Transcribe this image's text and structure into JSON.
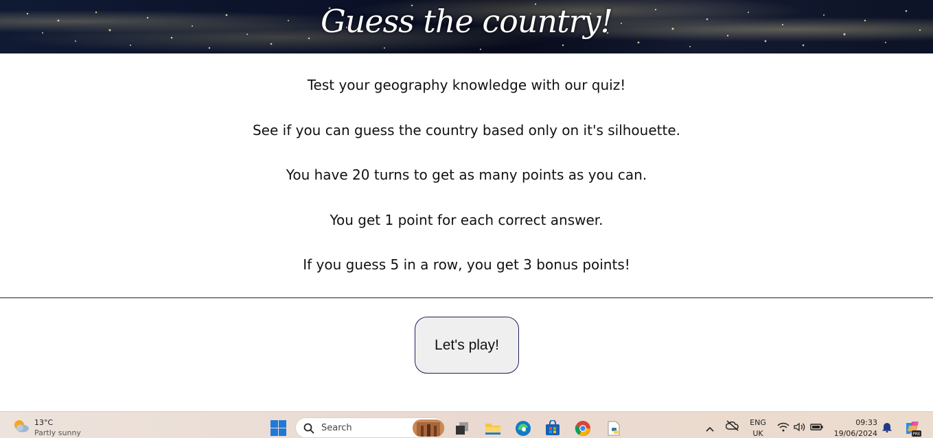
{
  "header": {
    "title": "Guess the country!"
  },
  "intro": {
    "lines": [
      "Test your geography knowledge with our quiz!",
      "See if you can guess the country based only on it's silhouette.",
      "You have 20 turns to get as many points as you can.",
      "You get 1 point for each correct answer.",
      "If you guess 5 in a row, you get 3 bonus points!"
    ]
  },
  "actions": {
    "play_label": "Let's play!"
  },
  "taskbar": {
    "weather": {
      "temperature": "13°C",
      "description": "Partly sunny",
      "icon": "partly-sunny-icon"
    },
    "search": {
      "placeholder": "Search"
    },
    "apps": [
      {
        "name": "start",
        "icon": "windows-logo-icon"
      },
      {
        "name": "task-view",
        "icon": "task-view-icon"
      },
      {
        "name": "file-explorer",
        "icon": "folder-icon"
      },
      {
        "name": "edge",
        "icon": "edge-icon"
      },
      {
        "name": "store",
        "icon": "store-icon"
      },
      {
        "name": "chrome",
        "icon": "chrome-icon"
      },
      {
        "name": "python",
        "icon": "python-file-icon"
      }
    ],
    "tray": {
      "language_top": "ENG",
      "language_bottom": "UK",
      "time": "09:33",
      "date": "19/06/2024",
      "copilot_badge": "PRE"
    },
    "colors": {
      "windows_blue": "#1e7ad6",
      "edge_blue": "#1379c9",
      "chrome_red": "#db4437",
      "chrome_green": "#0f9d58",
      "chrome_yellow": "#f4b400",
      "folder_yellow": "#f6c344"
    }
  }
}
